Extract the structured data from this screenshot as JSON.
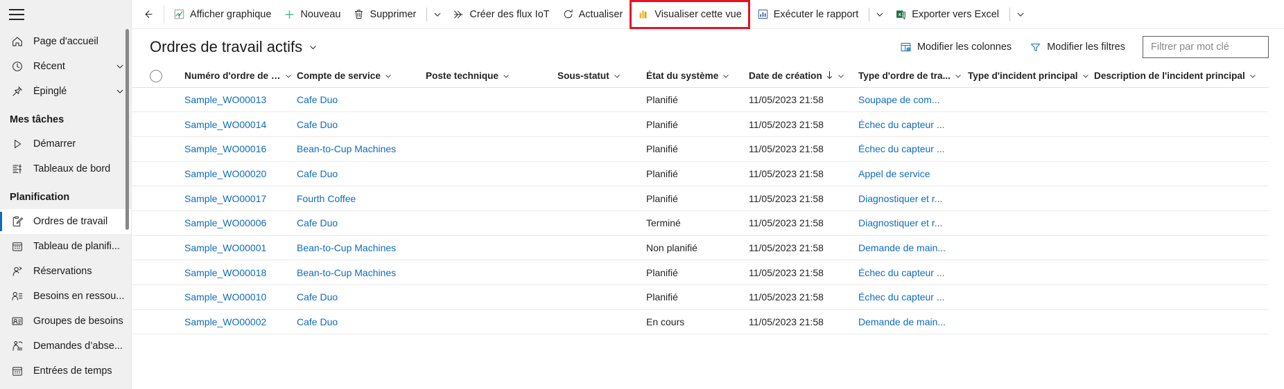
{
  "sidebar": {
    "hamburger_label": "Menu",
    "items": [
      {
        "label": "Page d'accueil",
        "icon": "home-icon",
        "chevron": false,
        "selected": false
      },
      {
        "label": "Récent",
        "icon": "clock-icon",
        "chevron": true,
        "selected": false
      },
      {
        "label": "Épinglé",
        "icon": "pin-icon",
        "chevron": true,
        "selected": false
      }
    ],
    "group_my_tasks": "Mes tâches",
    "my_tasks_items": [
      {
        "label": "Démarrer",
        "icon": "play-icon",
        "chevron": false,
        "selected": false
      },
      {
        "label": "Tableaux de bord",
        "icon": "dashboard-icon",
        "chevron": false,
        "selected": false
      }
    ],
    "group_planning": "Planification",
    "planning_items": [
      {
        "label": "Ordres de travail",
        "icon": "clipboard-icon",
        "chevron": false,
        "selected": true
      },
      {
        "label": "Tableau de planifi...",
        "icon": "calendar-icon",
        "chevron": false,
        "selected": false
      },
      {
        "label": "Réservations",
        "icon": "person-arrow-icon",
        "chevron": false,
        "selected": false
      },
      {
        "label": "Besoins en ressou...",
        "icon": "person-list-icon",
        "chevron": false,
        "selected": false
      },
      {
        "label": "Groupes de besoins",
        "icon": "id-card-icon",
        "chevron": false,
        "selected": false
      },
      {
        "label": "Demandes d’abse...",
        "icon": "absence-icon",
        "chevron": false,
        "selected": false
      },
      {
        "label": "Entrées de temps",
        "icon": "calendar-icon",
        "chevron": false,
        "selected": false
      }
    ]
  },
  "commandbar": {
    "back_label": "Retour",
    "buttons": [
      {
        "label": "Afficher graphique",
        "icon": "chart-icon",
        "caret": false,
        "divider_before": false,
        "highlighted": false
      },
      {
        "label": "Nouveau",
        "icon": "plus-icon",
        "caret": false,
        "divider_before": false,
        "highlighted": false
      },
      {
        "label": "Supprimer",
        "icon": "trash-icon",
        "caret": true,
        "divider_before": false,
        "highlighted": false
      },
      {
        "label": "Créer des flux IoT",
        "icon": "flow-icon",
        "caret": false,
        "divider_before": false,
        "highlighted": false
      },
      {
        "label": "Actualiser",
        "icon": "refresh-icon",
        "caret": false,
        "divider_before": false,
        "highlighted": false
      },
      {
        "label": "Visualiser cette vue",
        "icon": "powerbi-icon",
        "caret": false,
        "divider_before": false,
        "highlighted": true
      },
      {
        "label": "Exécuter le rapport",
        "icon": "report-icon",
        "caret": true,
        "divider_before": false,
        "highlighted": false
      },
      {
        "label": "Exporter vers Excel",
        "icon": "excel-icon",
        "caret": true,
        "divider_before": false,
        "highlighted": false
      }
    ],
    "highlight_color": "#e81123"
  },
  "view": {
    "title": "Ordres de travail actifs",
    "edit_columns_label": "Modifier les colonnes",
    "edit_filters_label": "Modifier les filtres",
    "search_placeholder": "Filtrer par mot clé",
    "search_value": ""
  },
  "grid": {
    "columns": [
      {
        "label": "",
        "key": "select",
        "sorted": false
      },
      {
        "label": "Numéro d'ordre de travail",
        "key": "wo_number",
        "sorted": false
      },
      {
        "label": "Compte de service",
        "key": "service_account",
        "sorted": false
      },
      {
        "label": "Poste technique",
        "key": "functional_location",
        "sorted": false
      },
      {
        "label": "Sous-statut",
        "key": "substatus",
        "sorted": false
      },
      {
        "label": "État du système",
        "key": "system_status",
        "sorted": false
      },
      {
        "label": "Date de création",
        "key": "created_on",
        "sorted": true,
        "sort_dir": "desc"
      },
      {
        "label": "Type d'ordre de tra...",
        "key": "wo_type",
        "sorted": false
      },
      {
        "label": "Type d'incident principal",
        "key": "primary_incident_type",
        "sorted": false
      },
      {
        "label": "Description de l'incident principal",
        "key": "primary_incident_desc",
        "sorted": false
      }
    ],
    "rows": [
      {
        "wo_number": "Sample_WO00013",
        "service_account": "Cafe Duo",
        "functional_location": "",
        "substatus": "",
        "system_status": "Planifié",
        "created_on": "11/05/2023 21:58",
        "wo_type": "Soupape de com...",
        "primary_incident_type": "",
        "primary_incident_desc": ""
      },
      {
        "wo_number": "Sample_WO00014",
        "service_account": "Cafe Duo",
        "functional_location": "",
        "substatus": "",
        "system_status": "Planifié",
        "created_on": "11/05/2023 21:58",
        "wo_type": "Échec du capteur ...",
        "primary_incident_type": "",
        "primary_incident_desc": ""
      },
      {
        "wo_number": "Sample_WO00016",
        "service_account": "Bean-to-Cup Machines",
        "functional_location": "",
        "substatus": "",
        "system_status": "Planifié",
        "created_on": "11/05/2023 21:58",
        "wo_type": "Échec du capteur ...",
        "primary_incident_type": "",
        "primary_incident_desc": ""
      },
      {
        "wo_number": "Sample_WO00020",
        "service_account": "Cafe Duo",
        "functional_location": "",
        "substatus": "",
        "system_status": "Planifié",
        "created_on": "11/05/2023 21:58",
        "wo_type": "Appel de service",
        "primary_incident_type": "",
        "primary_incident_desc": ""
      },
      {
        "wo_number": "Sample_WO00017",
        "service_account": "Fourth Coffee",
        "functional_location": "",
        "substatus": "",
        "system_status": "Planifié",
        "created_on": "11/05/2023 21:58",
        "wo_type": "Diagnostiquer et r...",
        "primary_incident_type": "",
        "primary_incident_desc": ""
      },
      {
        "wo_number": "Sample_WO00006",
        "service_account": "Cafe Duo",
        "functional_location": "",
        "substatus": "",
        "system_status": "Terminé",
        "created_on": "11/05/2023 21:58",
        "wo_type": "Diagnostiquer et r...",
        "primary_incident_type": "",
        "primary_incident_desc": ""
      },
      {
        "wo_number": "Sample_WO00001",
        "service_account": "Bean-to-Cup Machines",
        "functional_location": "",
        "substatus": "",
        "system_status": "Non planifié",
        "created_on": "11/05/2023 21:58",
        "wo_type": "Demande de main...",
        "primary_incident_type": "",
        "primary_incident_desc": ""
      },
      {
        "wo_number": "Sample_WO00018",
        "service_account": "Bean-to-Cup Machines",
        "functional_location": "",
        "substatus": "",
        "system_status": "Planifié",
        "created_on": "11/05/2023 21:58",
        "wo_type": "Échec du capteur ...",
        "primary_incident_type": "",
        "primary_incident_desc": ""
      },
      {
        "wo_number": "Sample_WO00010",
        "service_account": "Cafe Duo",
        "functional_location": "",
        "substatus": "",
        "system_status": "Planifié",
        "created_on": "11/05/2023 21:58",
        "wo_type": "Échec du capteur ...",
        "primary_incident_type": "",
        "primary_incident_desc": ""
      },
      {
        "wo_number": "Sample_WO00002",
        "service_account": "Cafe Duo",
        "functional_location": "",
        "substatus": "",
        "system_status": "En cours",
        "created_on": "11/05/2023 21:58",
        "wo_type": "Demande de main...",
        "primary_incident_type": "",
        "primary_incident_desc": ""
      }
    ]
  },
  "colors": {
    "link": "#0f6cbd",
    "sidebar_bg": "#f0f0f0",
    "accent": "#0f6cbd",
    "highlight": "#e81123"
  }
}
